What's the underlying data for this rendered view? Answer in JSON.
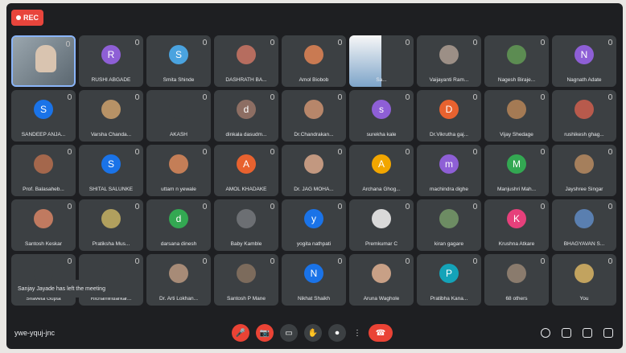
{
  "meeting": {
    "rec_label": "REC",
    "meeting_code": "ywe-yquj-jnc",
    "toast": "Sanjay Jayade has left the meeting"
  },
  "participants": [
    {
      "name": "",
      "initial": "",
      "color": "#6b7a86",
      "video": "self"
    },
    {
      "name": "RUSHI ABGADE",
      "initial": "R",
      "color": "#8e5fd6"
    },
    {
      "name": "Smita Shinde",
      "initial": "S",
      "color": "#4aa3df"
    },
    {
      "name": "DASHRATH BA...",
      "initial": "",
      "color": "#b66d5f"
    },
    {
      "name": "Amol Biobob",
      "initial": "",
      "color": "#c97a52"
    },
    {
      "name": "Sa...",
      "initial": "",
      "color": "#6aa7df",
      "video": "highlight"
    },
    {
      "name": "Vaijayanti Ram...",
      "initial": "",
      "color": "#9c8f86"
    },
    {
      "name": "Nagesh Biraje...",
      "initial": "",
      "color": "#5c8c52"
    },
    {
      "name": "Nagnath Adate",
      "initial": "N",
      "color": "#8e5fd6"
    },
    {
      "name": "SANDEEP ANJA...",
      "initial": "S",
      "color": "#1a73e8"
    },
    {
      "name": "Varsha Chanda...",
      "initial": "",
      "color": "#b79266"
    },
    {
      "name": "AKASH",
      "initial": "",
      "color": "#3c4043"
    },
    {
      "name": "dinkala dasudm...",
      "initial": "d",
      "color": "#8d6e63"
    },
    {
      "name": "Dr.Chandrakan...",
      "initial": "",
      "color": "#b7866a"
    },
    {
      "name": "surekha kale",
      "initial": "s",
      "color": "#8e5fd6"
    },
    {
      "name": "Dr.Vikrutha gaj...",
      "initial": "D",
      "color": "#e8622f"
    },
    {
      "name": "Vijay Shedage",
      "initial": "",
      "color": "#a47a54"
    },
    {
      "name": "rushikesh ghag...",
      "initial": "",
      "color": "#b85a4c"
    },
    {
      "name": "Prof. Balasaheb...",
      "initial": "",
      "color": "#a4674c"
    },
    {
      "name": "SHITAL SALUNKE",
      "initial": "S",
      "color": "#1a73e8"
    },
    {
      "name": "uttam n yewale",
      "initial": "",
      "color": "#c47e57"
    },
    {
      "name": "AMOL KHADAKE",
      "initial": "A",
      "color": "#e8622f"
    },
    {
      "name": "Dr. JAG MOHA...",
      "initial": "",
      "color": "#c29880"
    },
    {
      "name": "Archana Ghog...",
      "initial": "A",
      "color": "#f2a600"
    },
    {
      "name": "machindra dighe",
      "initial": "m",
      "color": "#8e5fd6"
    },
    {
      "name": "Manjushri Mah...",
      "initial": "M",
      "color": "#33a852"
    },
    {
      "name": "Jayshree Singar",
      "initial": "",
      "color": "#a57f5c"
    },
    {
      "name": "Santosh Keskar",
      "initial": "",
      "color": "#c07a60"
    },
    {
      "name": "Pratiksha Mus...",
      "initial": "",
      "color": "#b1a05e"
    },
    {
      "name": "darsana dinesh",
      "initial": "d",
      "color": "#33a852"
    },
    {
      "name": "Baby Kamble",
      "initial": "",
      "color": "#6c6f73"
    },
    {
      "name": "yogita nathpati",
      "initial": "y",
      "color": "#1a73e8"
    },
    {
      "name": "Premkumar C",
      "initial": "",
      "color": "#d9d9d9"
    },
    {
      "name": "kiran gagare",
      "initial": "",
      "color": "#6d8c63"
    },
    {
      "name": "Krushna Atkare",
      "initial": "K",
      "color": "#e6407b"
    },
    {
      "name": "BHAGYAVAN S...",
      "initial": "",
      "color": "#5a7fb0"
    },
    {
      "name": "Shaveta Gupta",
      "initial": "",
      "color": "#3c4043"
    },
    {
      "name": "Richamindarkar...",
      "initial": "",
      "color": "#3c4043"
    },
    {
      "name": "Dr. Arti Lokhan...",
      "initial": "",
      "color": "#a78b77"
    },
    {
      "name": "Santosh P Mane",
      "initial": "",
      "color": "#7c6b5c"
    },
    {
      "name": "Nikhat Shaikh",
      "initial": "N",
      "color": "#1a73e8"
    },
    {
      "name": "Aruna Waghole",
      "initial": "",
      "color": "#c8a086"
    },
    {
      "name": "Pratibha Kana...",
      "initial": "P",
      "color": "#14a3b8"
    },
    {
      "name": "68 others",
      "initial": "",
      "color": "#8a7b6d"
    },
    {
      "name": "You",
      "initial": "",
      "color": "#c2a35f"
    }
  ],
  "controls": [
    "mic-off",
    "camera-off",
    "captions",
    "raise-hand",
    "present",
    "more",
    "end-call"
  ],
  "right_controls": [
    "info",
    "people",
    "chat",
    "activities"
  ]
}
